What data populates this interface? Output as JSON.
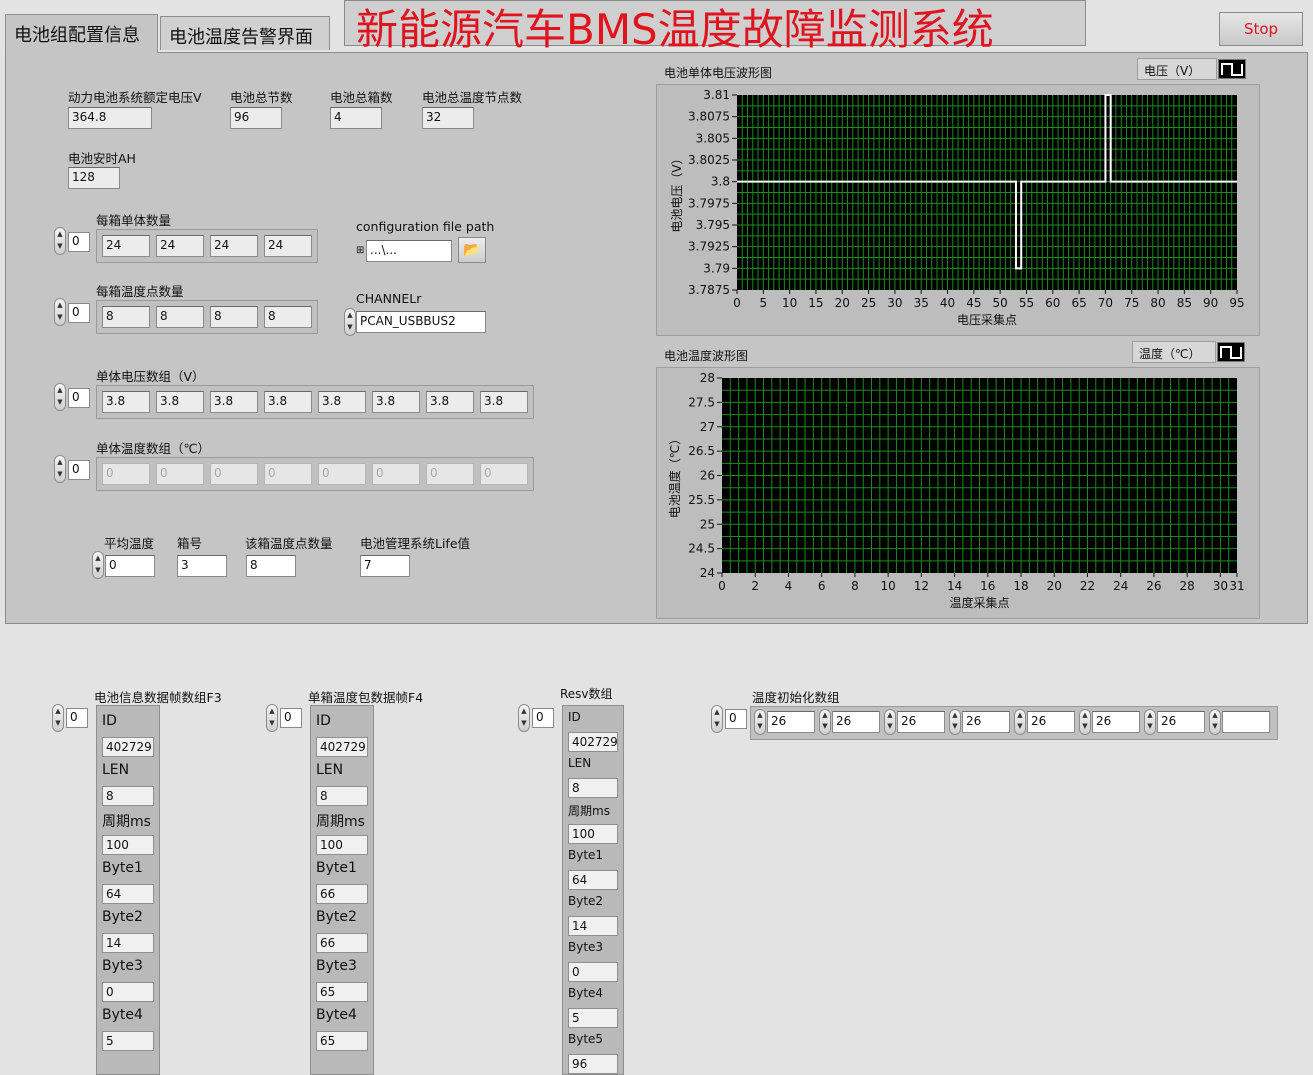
{
  "app": {
    "title": "新能源汽车BMS温度故障监测系统",
    "stop_label": "Stop"
  },
  "tabs": [
    {
      "label": "电池组配置信息"
    },
    {
      "label": "电池温度告警界面"
    }
  ],
  "config": {
    "rated_voltage": {
      "label": "动力电池系统额定电压V",
      "value": "364.8"
    },
    "total_cells": {
      "label": "电池总节数",
      "value": "96"
    },
    "total_boxes": {
      "label": "电池总箱数",
      "value": "4"
    },
    "total_temp_nodes": {
      "label": "电池总温度节点数",
      "value": "32"
    },
    "amp_hours": {
      "label": "电池安时AH",
      "value": "128"
    },
    "cells_per_box": {
      "label": "每箱单体数量",
      "index": "0",
      "values": [
        "24",
        "24",
        "24",
        "24"
      ]
    },
    "config_path": {
      "label": "configuration file path",
      "value": "...\\..."
    },
    "temps_per_box": {
      "label": "每箱温度点数量",
      "index": "0",
      "values": [
        "8",
        "8",
        "8",
        "8"
      ]
    },
    "channel": {
      "label": "CHANNELr",
      "value": "PCAN_USBBUS2"
    },
    "cell_voltages": {
      "label": "单体电压数组（V）",
      "index": "0",
      "values": [
        "3.8",
        "3.8",
        "3.8",
        "3.8",
        "3.8",
        "3.8",
        "3.8",
        "3.8"
      ]
    },
    "cell_temps": {
      "label": "单体温度数组（℃）",
      "index": "0",
      "values": [
        "0",
        "0",
        "0",
        "0",
        "0",
        "0",
        "0",
        "0"
      ]
    },
    "avg_temp": {
      "label": "平均温度",
      "value": "0"
    },
    "box_no": {
      "label": "箱号",
      "value": "3"
    },
    "box_temp_points": {
      "label": "该箱温度点数量",
      "value": "8"
    },
    "life_value": {
      "label": "电池管理系统Life值",
      "value": "7"
    }
  },
  "voltage_chart": {
    "panel_title": "电池单体电压波形图",
    "legend": "电压（V）"
  },
  "temp_chart": {
    "panel_title": "电池温度波形图",
    "legend": "温度（℃）"
  },
  "chart_data": [
    {
      "type": "line",
      "title": "电池单体电压波形图",
      "xlabel": "电压采集点",
      "ylabel": "电池电压（V）",
      "xlim": [
        0,
        95
      ],
      "ylim": [
        3.7875,
        3.81
      ],
      "xticks": [
        "0",
        "5",
        "10",
        "15",
        "20",
        "25",
        "30",
        "35",
        "40",
        "45",
        "50",
        "55",
        "60",
        "65",
        "70",
        "75",
        "80",
        "85",
        "90",
        "95"
      ],
      "yticks": [
        "3.81",
        "3.8075",
        "3.805",
        "3.8025",
        "3.8",
        "3.7975",
        "3.795",
        "3.7925",
        "3.79",
        "3.7875"
      ],
      "series": [
        {
          "name": "电压（V）",
          "color": "#ffffff",
          "x": [
            0,
            53,
            53,
            54,
            54,
            70,
            70,
            71,
            71,
            95
          ],
          "y": [
            3.8,
            3.8,
            3.79,
            3.79,
            3.8,
            3.8,
            3.81,
            3.81,
            3.8,
            3.8
          ]
        }
      ],
      "grid": true,
      "grid_color": "#1f8a1f"
    },
    {
      "type": "line",
      "title": "电池温度波形图",
      "xlabel": "温度采集点",
      "ylabel": "电池温度（℃）",
      "xlim": [
        0,
        31
      ],
      "ylim": [
        24,
        28
      ],
      "xticks": [
        "0",
        "2",
        "4",
        "6",
        "8",
        "10",
        "12",
        "14",
        "16",
        "18",
        "20",
        "22",
        "24",
        "26",
        "28",
        "30",
        "31"
      ],
      "yticks": [
        "28",
        "27.5",
        "27",
        "26.5",
        "26",
        "25.5",
        "25",
        "24.5",
        "24"
      ],
      "series": [
        {
          "name": "温度（℃）",
          "color": "#ffffff",
          "x": [],
          "y": []
        }
      ],
      "grid": true,
      "grid_color": "#1f8a1f"
    }
  ],
  "clusters": {
    "f3": {
      "title": "电池信息数据帧数组F3",
      "index": "0",
      "fields": [
        {
          "label": "ID",
          "value": "402729"
        },
        {
          "label": "LEN",
          "value": "8"
        },
        {
          "label": "周期ms",
          "value": "100"
        },
        {
          "label": "Byte1",
          "value": "64"
        },
        {
          "label": "Byte2",
          "value": "14"
        },
        {
          "label": "Byte3",
          "value": "0"
        },
        {
          "label": "Byte4",
          "value": "5"
        }
      ]
    },
    "f4": {
      "title": "单箱温度包数据帧F4",
      "index": "0",
      "fields": [
        {
          "label": "ID",
          "value": "402729"
        },
        {
          "label": "LEN",
          "value": "8"
        },
        {
          "label": "周期ms",
          "value": "100"
        },
        {
          "label": "Byte1",
          "value": "66"
        },
        {
          "label": "Byte2",
          "value": "66"
        },
        {
          "label": "Byte3",
          "value": "65"
        },
        {
          "label": "Byte4",
          "value": "65"
        }
      ]
    },
    "resv": {
      "title": "Resv数组",
      "index": "0",
      "fields": [
        {
          "label": "ID",
          "value": "402729"
        },
        {
          "label": "LEN",
          "value": "8"
        },
        {
          "label": "周期ms",
          "value": "100"
        },
        {
          "label": "Byte1",
          "value": "64"
        },
        {
          "label": "Byte2",
          "value": "14"
        },
        {
          "label": "Byte3",
          "value": "0"
        },
        {
          "label": "Byte4",
          "value": "5"
        },
        {
          "label": "Byte5",
          "value": "96"
        }
      ]
    }
  },
  "temp_init": {
    "label": "温度初始化数组",
    "index": "0",
    "values": [
      "26",
      "26",
      "26",
      "26",
      "26",
      "26",
      "26",
      ""
    ]
  }
}
